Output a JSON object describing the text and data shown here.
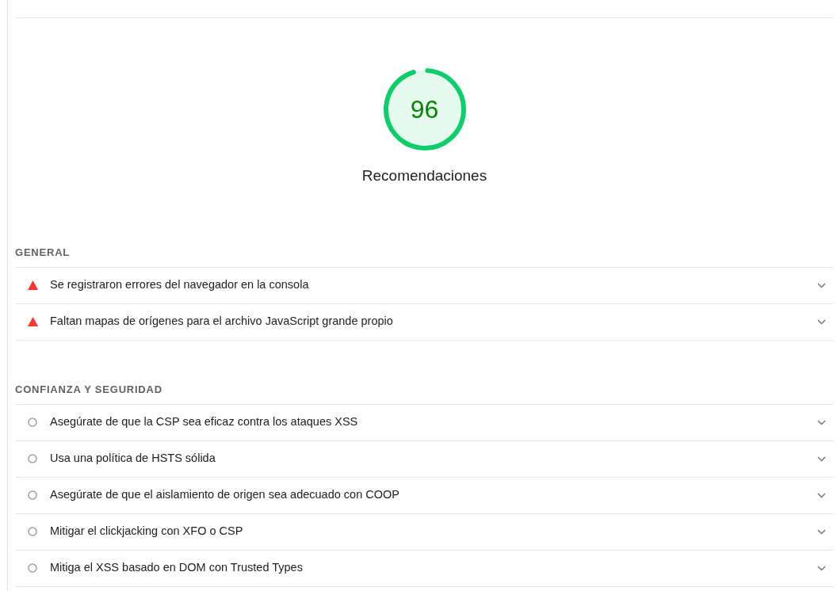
{
  "gauge": {
    "score": "96",
    "title": "Recomendaciones"
  },
  "groups": [
    {
      "title": "GENERAL",
      "audits": [
        {
          "kind": "fail",
          "title": "Se registraron errores del navegador en la consola"
        },
        {
          "kind": "fail",
          "title": "Faltan mapas de orígenes para el archivo JavaScript grande propio"
        }
      ]
    },
    {
      "title": "CONFIANZA Y SEGURIDAD",
      "audits": [
        {
          "kind": "manual",
          "title": "Asegúrate de que la CSP sea eficaz contra los ataques XSS"
        },
        {
          "kind": "manual",
          "title": "Usa una política de HSTS sólida"
        },
        {
          "kind": "manual",
          "title": "Asegúrate de que el aislamiento de origen sea adecuado con COOP"
        },
        {
          "kind": "manual",
          "title": "Mitigar el clickjacking con XFO o CSP"
        },
        {
          "kind": "manual",
          "title": "Mitiga el XSS basado en DOM con Trusted Types"
        }
      ]
    }
  ]
}
